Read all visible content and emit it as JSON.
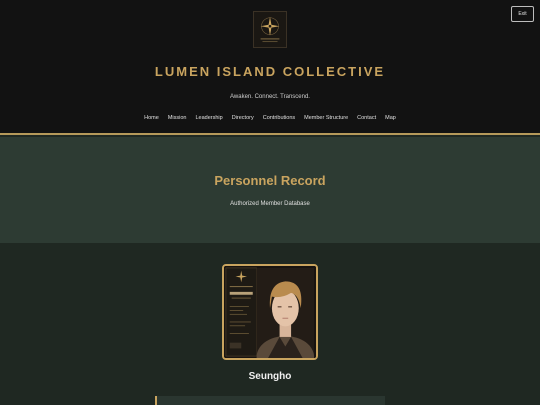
{
  "header": {
    "logo_icon": "compass-star-emblem-icon",
    "exit_label": "Exit",
    "title": "LUMEN ISLAND COLLECTIVE",
    "tagline": "Awaken. Connect. Transcend."
  },
  "nav": {
    "items": [
      "Home",
      "Mission",
      "Leadership",
      "Directory",
      "Contributions",
      "Member Structure",
      "Contact",
      "Map"
    ]
  },
  "hero": {
    "title": "Personnel Record",
    "subtitle": "Authorized Member Database"
  },
  "profile": {
    "photo_icon": "member-id-card-portrait",
    "name": "Seungho"
  },
  "colors": {
    "accent_gold": "#c9a45f",
    "header_bg": "#121212",
    "hero_bg": "#2d3b33",
    "page_bg": "#1f2822"
  }
}
